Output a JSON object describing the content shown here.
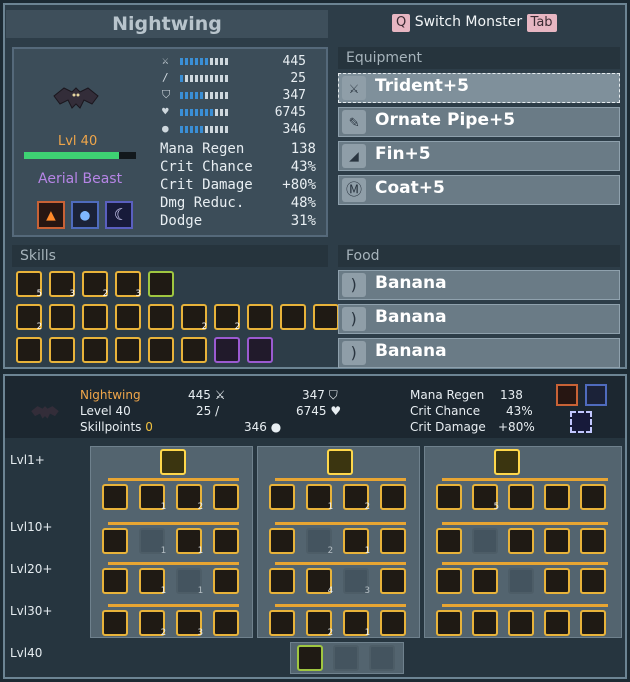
{
  "header": {
    "title": "Nightwing",
    "switch_key": "Q",
    "switch_label": "Switch Monster",
    "tab_key": "Tab"
  },
  "monster": {
    "level": "Lvl 40",
    "type": "Aerial Beast",
    "xp_fraction": 0.85
  },
  "stats": [
    {
      "icon": "sword-icon",
      "value": "445",
      "fill": 0.55
    },
    {
      "icon": "wand-icon",
      "value": "25",
      "fill": 0.1
    },
    {
      "icon": "shield-icon",
      "value": "347",
      "fill": 0.45
    },
    {
      "icon": "heart-icon",
      "value": "6745",
      "fill": 0.7
    },
    {
      "icon": "mana-icon",
      "value": "346",
      "fill": 0.45
    }
  ],
  "attributes": [
    {
      "label": "Mana Regen",
      "value": "138"
    },
    {
      "label": "Crit Chance",
      "value": "43%"
    },
    {
      "label": "Crit Damage",
      "value": "+80%"
    },
    {
      "label": "Dmg Reduc.",
      "value": "48%"
    },
    {
      "label": "Dodge",
      "value": "31%"
    }
  ],
  "equipment": {
    "title": "Equipment",
    "items": [
      "Trident+5",
      "Ornate Pipe+5",
      "Fin+5",
      "Coat+5"
    ]
  },
  "food": {
    "title": "Food",
    "items": [
      "Banana",
      "Banana",
      "Banana"
    ]
  },
  "skills": {
    "title": "Skills",
    "counts": [
      "5",
      "3",
      "2",
      "3",
      "",
      "2",
      "",
      "",
      "",
      "",
      "2",
      "2",
      "",
      "",
      "",
      "",
      "",
      "",
      "",
      "",
      "",
      "",
      ""
    ]
  },
  "summary": {
    "name": "Nightwing",
    "level": "Level 40",
    "skillpoints_label": "Skillpoints",
    "skillpoints": "0",
    "sword": "445",
    "wand": "25",
    "shield": "347",
    "heart": "6745",
    "mana": "346",
    "mana_regen_label": "Mana Regen",
    "mana_regen": "138",
    "crit_chance_label": "Crit Chance",
    "crit_chance": "43%",
    "crit_damage_label": "Crit Damage",
    "crit_damage": "+80%"
  },
  "tree": {
    "levels": [
      "Lvl1+",
      "Lvl10+",
      "Lvl20+",
      "Lvl30+",
      "Lvl40"
    ],
    "node_counts": [
      "1",
      "2",
      "1",
      "1",
      "1",
      "1",
      "2",
      "3",
      "1",
      "2",
      "2",
      "1",
      "4",
      "3",
      "2",
      "1",
      "5"
    ]
  },
  "colors": {
    "accent": "#e8b33a",
    "title_orange": "#f0a64a",
    "type_purple": "#b685e6"
  }
}
